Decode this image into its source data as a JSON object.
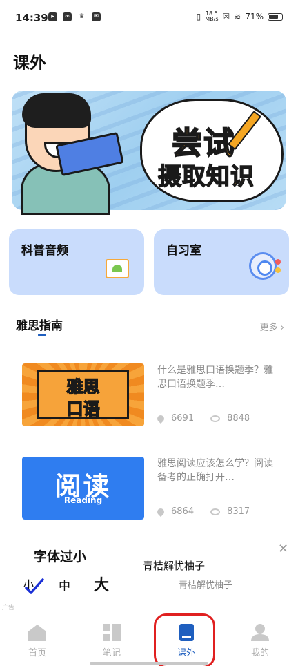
{
  "status_bar": {
    "time": "14:39",
    "speed_top": "18.5",
    "speed_unit": "MB/s",
    "battery": "71%"
  },
  "page": {
    "title": "课外"
  },
  "banner": {
    "line1": "尝试",
    "line2": "摄取知识"
  },
  "cards": [
    {
      "label": "科普音频",
      "icon": "easel-icon"
    },
    {
      "label": "自习室",
      "icon": "study-circle-icon"
    }
  ],
  "section": {
    "title": "雅思指南",
    "more": "更多 ›"
  },
  "articles": [
    {
      "thumb_line1": "雅思",
      "thumb_line2": "口语",
      "text": "什么是雅思口语换题季？雅思口语换题季…",
      "likes": "6691",
      "views": "8848"
    },
    {
      "thumb_big": "阅读",
      "thumb_small": "Reading",
      "text": "雅思阅读应该怎么学？阅读备考的正确打开…",
      "likes": "6864",
      "views": "8317"
    }
  ],
  "font_popup": {
    "title": "字体过小",
    "small": "小",
    "medium": "中",
    "large": "大",
    "selected": "小"
  },
  "ad": {
    "title": "青桔解忧柚子",
    "subtitle": "青桔解忧柚子",
    "label": "广告"
  },
  "tabbar": {
    "items": [
      {
        "label": "首页",
        "icon": "home-icon"
      },
      {
        "label": "笔记",
        "icon": "notes-icon"
      },
      {
        "label": "课外",
        "icon": "book-icon",
        "active": true
      },
      {
        "label": "我的",
        "icon": "profile-icon"
      }
    ]
  },
  "colors": {
    "accent": "#1f5fbf",
    "card_bg": "#c9dcfc",
    "highlight": "#e02020"
  }
}
